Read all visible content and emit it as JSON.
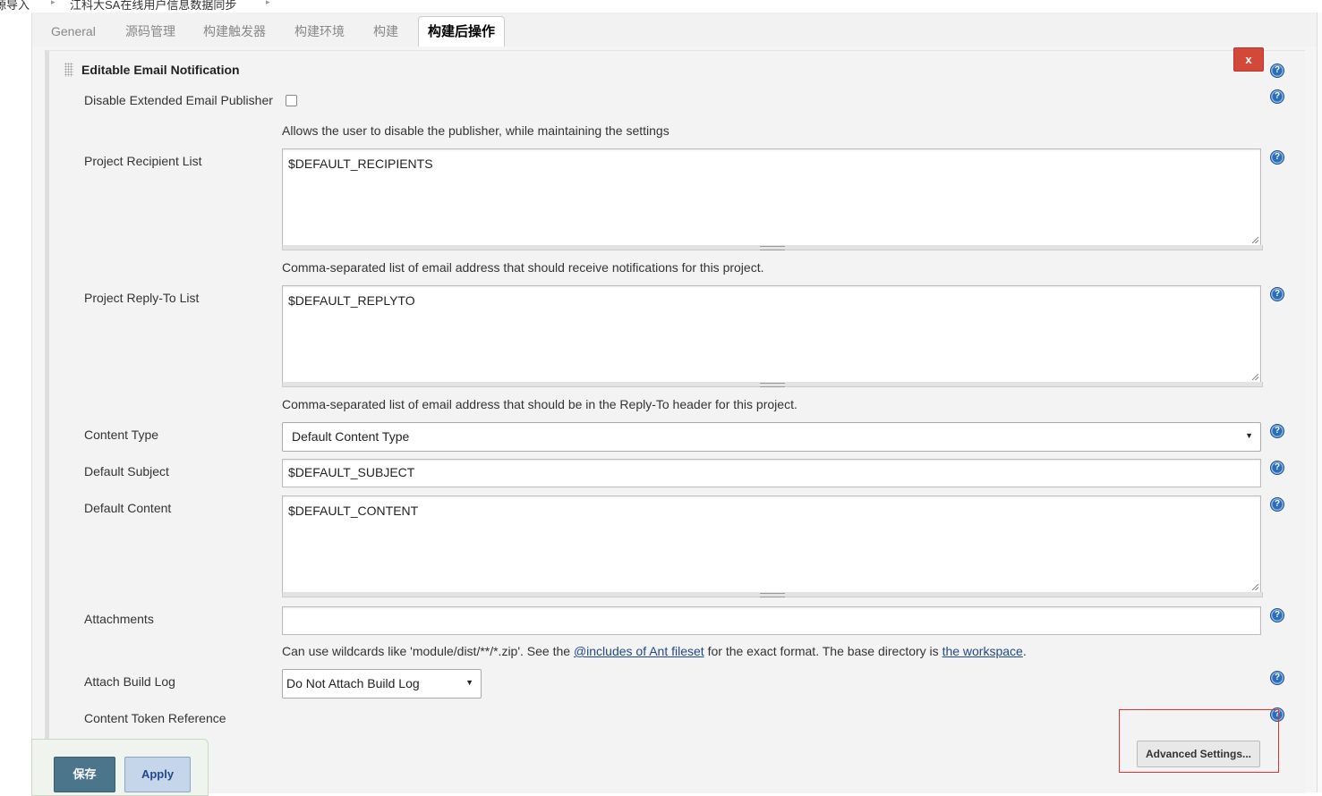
{
  "breadcrumb": {
    "items": [
      "源导入",
      "江科大SA在线用户信息数据同步"
    ]
  },
  "tabs": [
    {
      "label": "General",
      "active": false
    },
    {
      "label": "源码管理",
      "active": false
    },
    {
      "label": "构建触发器",
      "active": false
    },
    {
      "label": "构建环境",
      "active": false
    },
    {
      "label": "构建",
      "active": false
    },
    {
      "label": "构建后操作",
      "active": true
    }
  ],
  "section": {
    "title": "Editable Email Notification",
    "close_label": "x"
  },
  "fields": {
    "disable_publisher": {
      "label": "Disable Extended Email Publisher",
      "checked": false,
      "description": "Allows the user to disable the publisher, while maintaining the settings"
    },
    "recipient_list": {
      "label": "Project Recipient List",
      "value": "$DEFAULT_RECIPIENTS",
      "description": "Comma-separated list of email address that should receive notifications for this project."
    },
    "reply_to_list": {
      "label": "Project Reply-To List",
      "value": "$DEFAULT_REPLYTO",
      "description": "Comma-separated list of email address that should be in the Reply-To header for this project."
    },
    "content_type": {
      "label": "Content Type",
      "value": "Default Content Type"
    },
    "default_subject": {
      "label": "Default Subject",
      "value": "$DEFAULT_SUBJECT"
    },
    "default_content": {
      "label": "Default Content",
      "value": "$DEFAULT_CONTENT"
    },
    "attachments": {
      "label": "Attachments",
      "value": "",
      "description_prefix": "Can use wildcards like 'module/dist/**/*.zip'. See the ",
      "description_link1": "@includes of Ant fileset",
      "description_middle": " for the exact format. The base directory is ",
      "description_link2": "the workspace",
      "description_suffix": "."
    },
    "attach_build_log": {
      "label": "Attach Build Log",
      "value": "Do Not Attach Build Log"
    },
    "content_token_reference": {
      "label": "Content Token Reference"
    }
  },
  "buttons": {
    "advanced": "Advanced Settings...",
    "save": "保存",
    "apply": "Apply"
  },
  "icons": {
    "help": "help-icon",
    "grip": "drag-handle-icon"
  },
  "colors": {
    "close_button": "#d24939",
    "save_button": "#4b758b",
    "apply_button": "#c5d6ea",
    "help_icon": "#2a6ebb",
    "highlight_box": "#e03030"
  }
}
